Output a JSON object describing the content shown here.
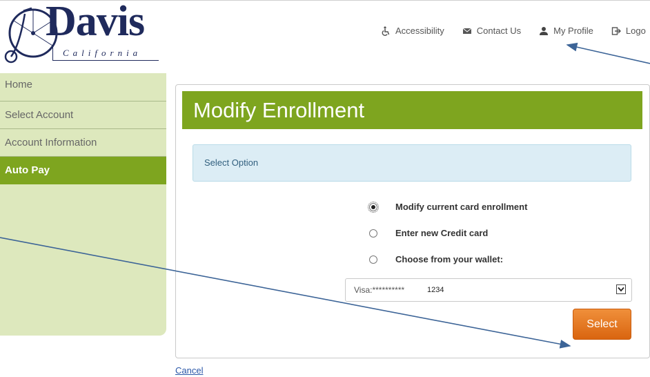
{
  "logo": {
    "name": "Davis",
    "subtitle": "California"
  },
  "topnav": {
    "accessibility": "Accessibility",
    "contact": "Contact Us",
    "profile": "My Profile",
    "logout": "Logo"
  },
  "sidebar": {
    "items": [
      {
        "label": "Home"
      },
      {
        "label": "Select Account"
      },
      {
        "label": "Account Information"
      },
      {
        "label": "Auto Pay"
      }
    ]
  },
  "panel": {
    "title": "Modify Enrollment",
    "option_heading": "Select Option",
    "options": [
      {
        "label": "Modify current card enrollment",
        "checked": true
      },
      {
        "label": "Enter new Credit card",
        "checked": false
      },
      {
        "label": "Choose from your wallet:",
        "checked": false
      }
    ],
    "wallet_select": {
      "value": "Visa:**********",
      "last4": "1234"
    },
    "select_button": "Select"
  },
  "cancel_link": "Cancel",
  "colors": {
    "brand_green": "#7ea51f",
    "sidebar_bg": "#dde8bd",
    "info_bg": "#dcedf5",
    "button_orange": "#e3741f",
    "logo_navy": "#1f2a5c",
    "annotation_arrow": "#3c6497"
  }
}
